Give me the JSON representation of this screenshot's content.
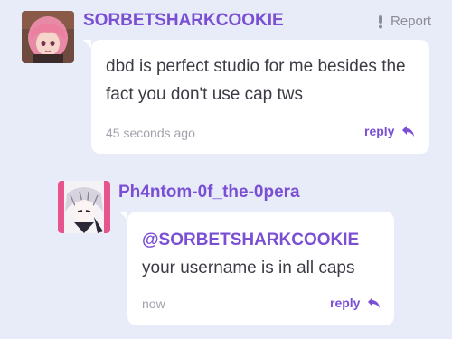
{
  "report_label": "Report",
  "comments": [
    {
      "username": "SORBETSHARKCOOKIE",
      "message": "dbd is perfect studio for me besides the fact you don't use cap tws",
      "time": "45 seconds ago",
      "reply_label": "reply"
    },
    {
      "username": "Ph4ntom-0f_the-0pera",
      "mention": "@SORBETSHARKCOOKIE",
      "message": " your username is in all caps",
      "time": "now",
      "reply_label": "reply"
    }
  ],
  "colors": {
    "background": "#e7ecf8",
    "accent": "#7a4fd4",
    "bubble": "#ffffff",
    "text": "#3b3b45",
    "muted": "#a2a2ad"
  }
}
